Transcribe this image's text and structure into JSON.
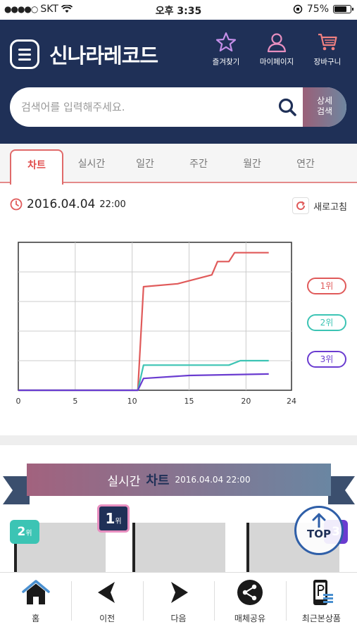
{
  "status_bar": {
    "carrier": "SKT",
    "time": "오후 3:35",
    "battery": "75%"
  },
  "header": {
    "logo": "신나라레코드",
    "icons": [
      {
        "label": "즐겨찾기",
        "icon": "star-icon"
      },
      {
        "label": "마이페이지",
        "icon": "user-icon"
      },
      {
        "label": "장바구니",
        "icon": "cart-icon"
      }
    ]
  },
  "search": {
    "placeholder": "검색어를 입력해주세요.",
    "detail_label_1": "상세",
    "detail_label_2": "검색"
  },
  "tabs": [
    "차트",
    "실시간",
    "일간",
    "주간",
    "월간",
    "연간"
  ],
  "active_tab": "차트",
  "datetime": {
    "date": "2016.04.04",
    "time": "22:00"
  },
  "refresh_label": "새로고침",
  "chart_data": {
    "type": "line",
    "x_ticks": [
      "0",
      "5",
      "10",
      "15",
      "20",
      "24"
    ],
    "xlim": [
      0,
      24
    ],
    "ylim": [
      0,
      100
    ],
    "grid": true,
    "legend_position": "right",
    "series": [
      {
        "name": "1위",
        "color": "#e05a5a",
        "x": [
          0,
          10.5,
          11,
          14,
          17,
          17.5,
          18.5,
          19,
          22
        ],
        "y": [
          0,
          0,
          70,
          72,
          78,
          87,
          87,
          93,
          93
        ]
      },
      {
        "name": "2위",
        "color": "#3cc4b4",
        "x": [
          0,
          10.5,
          11,
          18.5,
          19.5,
          22
        ],
        "y": [
          0,
          0,
          17,
          17,
          20,
          20
        ]
      },
      {
        "name": "3위",
        "color": "#6a3cd0",
        "x": [
          0,
          10.5,
          11,
          15,
          22
        ],
        "y": [
          0,
          0,
          8,
          10,
          11
        ]
      }
    ]
  },
  "realtime_banner": {
    "label_1": "실시간",
    "label_2": "차트",
    "date": "2016.04.04 22:00"
  },
  "rank_badges": [
    {
      "num": "1",
      "suffix": "위",
      "color": "#1f3057"
    },
    {
      "num": "2",
      "suffix": "위",
      "color": "#3cc4b4"
    },
    {
      "num": "3",
      "suffix": "위",
      "color": "#6a3cd0"
    }
  ],
  "top_button": "TOP",
  "bottom_nav": [
    {
      "label": "홈",
      "icon": "home-icon"
    },
    {
      "label": "이전",
      "icon": "back-arrow-icon"
    },
    {
      "label": "다음",
      "icon": "forward-arrow-icon"
    },
    {
      "label": "매체공유",
      "icon": "share-icon"
    },
    {
      "label": "최근본상품",
      "icon": "recent-products-icon"
    }
  ]
}
